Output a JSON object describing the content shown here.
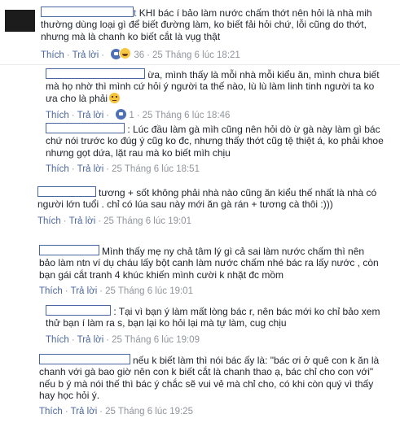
{
  "actions": {
    "like": "Thích",
    "reply": "Trả lời",
    "sep": "·"
  },
  "comments": [
    {
      "name_tail": "t",
      "text": "KHI bác í bảo làm nước chấm thớt nên hỏi là nhà mih thường dùng loại gì để biết đường làm, ko biết fải hỏi chứ, lỗi cũng do thớt, nhưng mà là chanh ko biết cắt là vụg thật",
      "reactions": "36",
      "time": "25 Tháng 6 lúc 18:21"
    },
    {
      "text": "ừa, mình thấy là mỗi nhà mỗi kiểu ăn, mình chưa biết mà họ nhờ thì mình cứ hỏi ý người ta thế nào, lù lù làm linh tinh người ta ko ưa cho là phải",
      "reactions": "1",
      "time": "25 Tháng 6 lúc 18:46"
    },
    {
      "text": ": Lúc đầu làm gà mìh cũng nên hỏi dò ừ gà này làm gì bác chứ nói trước ko đúg ý cũg ko đc, nhưng thấy thớt cũg tệ thiệt á, ko phải khoe nhưng gọt dứa, lặt rau mà ko biết mìh chịu",
      "time": "25 Tháng 6 lúc 18:51"
    },
    {
      "text": "tương + sốt không phải nhà nào cũng ăn kiểu thế nhất là nhà có người lớn tuổi . chỉ có lúa sau này mới ăn gà rán + tương cà thôi :)))",
      "time": "25 Tháng 6 lúc 19:01"
    },
    {
      "text": "Mình thấy mẹ ny chả tâm lý gì cả sai làm nước chấm thì nên bảo làm ntn ví dụ cháu lấy bột canh làm nước chấm nhé bác ra lấy nước , còn bạn gái cắt tranh 4 khúc khiến mình cười k nhặt đc mồm",
      "time": "25 Tháng 6 lúc 19:01"
    },
    {
      "text": ": Tại vì bạn ý làm mất lòng bác r, nên bác mới ko chỉ bảo xem thử bạn í làm ra s, bạn lại ko hỏi lại mà tự làm, cug chịu",
      "time": "25 Tháng 6 lúc 19:09"
    },
    {
      "text": "nếu k biết làm thì nói bác ấy là: \"bác ơi ở quê con k ăn là chanh với gà bao giờ nên con k biết cắt là chanh thao ạ, bác chỉ cho con với\" nếu b ý mà nói thế thì bác ý chắc sẽ vui vẻ mà chỉ cho, có khi còn quý vì thấy hay học hỏi ý.",
      "time": "25 Tháng 6 lúc 19:25"
    }
  ]
}
